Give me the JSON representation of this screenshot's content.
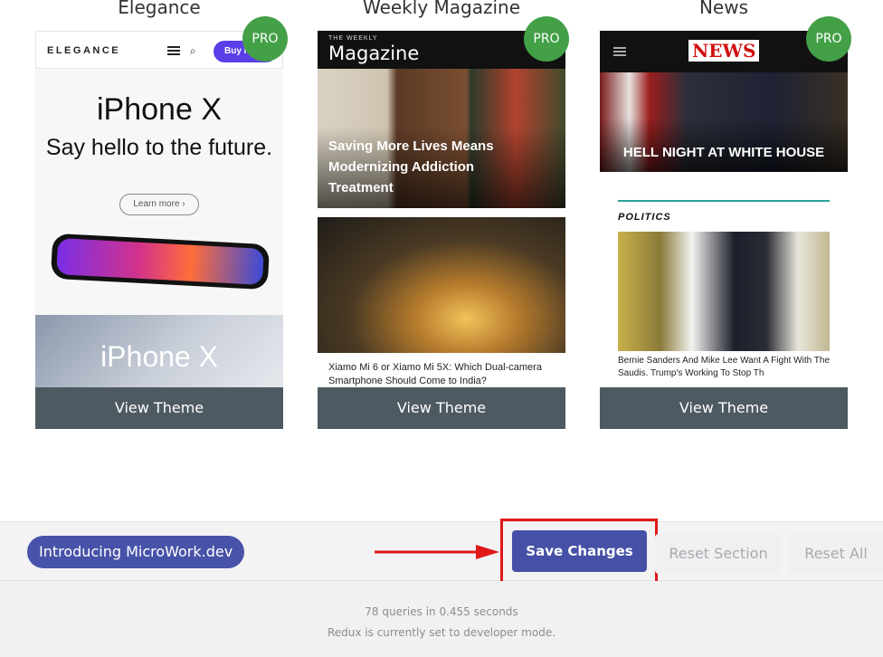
{
  "themes": [
    {
      "title": "Elegance",
      "badge": "PRO",
      "view_label": "View Theme",
      "preview": {
        "logo": "ELEGANCE",
        "buy_label": "Buy N",
        "headline": "iPhone X",
        "subhead": "Say hello to the future.",
        "learn_more": "Learn more ›",
        "banner2_text": "iPhone X"
      }
    },
    {
      "title": "Weekly Magazine",
      "badge": "PRO",
      "view_label": "View Theme",
      "preview": {
        "masthead_small": "THE WEEKLY",
        "masthead": "Magazine",
        "hero_headline": "Saving More Lives Means Modernizing Addiction Treatment",
        "caption": "Xiamo Mi 6 or Xiamo Mi 5X: Which Dual-camera Smartphone Should Come to India?"
      }
    },
    {
      "title": "News",
      "badge": "PRO",
      "view_label": "View Theme",
      "preview": {
        "logo": "NEWS",
        "hero_headline": "HELL NIGHT AT WHITE HOUSE",
        "category": "POLITICS",
        "caption": "Bernie Sanders And Mike Lee Want A Fight With The Saudis. Trump's Working To Stop Th"
      }
    }
  ],
  "action_bar": {
    "intro_label": "Introducing MicroWork.dev",
    "save_label": "Save Changes",
    "reset_section_label": "Reset Section",
    "reset_all_label": "Reset All",
    "highlight_color": "#e01818",
    "save_color": "#4550a6"
  },
  "footer": {
    "queries": "78 queries in 0.455 seconds",
    "mode": "Redux is currently set to developer mode."
  }
}
